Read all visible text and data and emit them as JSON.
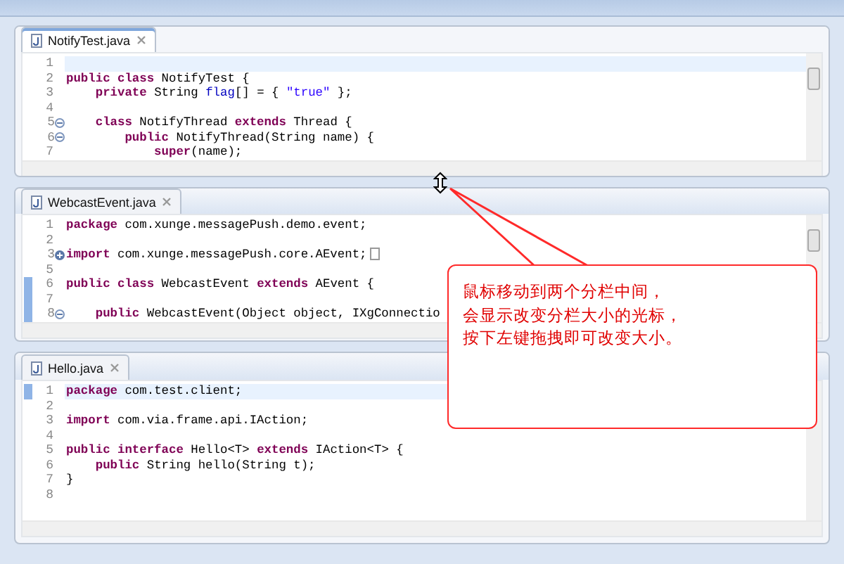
{
  "editors": [
    {
      "tab": {
        "label": "NotifyTest.java",
        "selected": true
      },
      "lines": [
        {
          "number": "1",
          "current": true
        },
        {
          "number": "2",
          "segments": [
            {
              "kind": "keyword",
              "text": "public class"
            },
            {
              "kind": "plain",
              "text": " NotifyTest {"
            }
          ]
        },
        {
          "number": "3",
          "segments": [
            {
              "kind": "keyword",
              "text": "    private"
            },
            {
              "kind": "plain",
              "text": " String "
            },
            {
              "kind": "field",
              "text": "flag"
            },
            {
              "kind": "plain",
              "text": "[] = { "
            },
            {
              "kind": "string",
              "text": "\"true\""
            },
            {
              "kind": "plain",
              "text": " };"
            }
          ]
        },
        {
          "number": "4"
        },
        {
          "number": "5",
          "fold": {
            "collapsed": false
          },
          "segments": [
            {
              "kind": "keyword",
              "text": "    class"
            },
            {
              "kind": "plain",
              "text": " NotifyThread "
            },
            {
              "kind": "keyword",
              "text": "extends"
            },
            {
              "kind": "plain",
              "text": " Thread {"
            }
          ]
        },
        {
          "number": "6",
          "fold": {
            "collapsed": false
          },
          "segments": [
            {
              "kind": "keyword",
              "text": "        public"
            },
            {
              "kind": "plain",
              "text": " NotifyThread(String name) {"
            }
          ]
        },
        {
          "number": "7",
          "segments": [
            {
              "kind": "keyword",
              "text": "            super"
            },
            {
              "kind": "plain",
              "text": "(name);"
            }
          ]
        }
      ]
    },
    {
      "tab": {
        "label": "WebcastEvent.java",
        "selected": false
      },
      "lines": [
        {
          "number": "1",
          "segments": [
            {
              "kind": "keyword",
              "text": "package"
            },
            {
              "kind": "plain",
              "text": " com.xunge.messagePush.demo.event;"
            }
          ]
        },
        {
          "number": "2"
        },
        {
          "number": "3",
          "fold": {
            "collapsed": true
          },
          "segments": [
            {
              "kind": "keyword",
              "text": "import"
            },
            {
              "kind": "plain",
              "text": " com.xunge.messagePush.core.AEvent;"
            }
          ]
        },
        {
          "number": "5"
        },
        {
          "number": "6",
          "changed": true,
          "segments": [
            {
              "kind": "keyword",
              "text": "public class"
            },
            {
              "kind": "plain",
              "text": " WebcastEvent "
            },
            {
              "kind": "keyword",
              "text": "extends"
            },
            {
              "kind": "plain",
              "text": " AEvent {"
            }
          ]
        },
        {
          "number": "7",
          "changed": true
        },
        {
          "number": "8",
          "changed": true,
          "fold": {
            "collapsed": false
          },
          "segments": [
            {
              "kind": "keyword",
              "text": "    public"
            },
            {
              "kind": "plain",
              "text": " WebcastEvent(Object object, IXgConnectio"
            }
          ]
        }
      ]
    },
    {
      "tab": {
        "label": "Hello.java",
        "selected": false
      },
      "lines": [
        {
          "number": "1",
          "current": true,
          "changed": true,
          "segments": [
            {
              "kind": "keyword",
              "text": "package"
            },
            {
              "kind": "plain",
              "text": " com.test.client;"
            }
          ]
        },
        {
          "number": "2"
        },
        {
          "number": "3",
          "segments": [
            {
              "kind": "keyword",
              "text": "import"
            },
            {
              "kind": "plain",
              "text": " com.via.frame.api.IAction;"
            }
          ]
        },
        {
          "number": "4"
        },
        {
          "number": "5",
          "segments": [
            {
              "kind": "keyword",
              "text": "public interface"
            },
            {
              "kind": "plain",
              "text": " Hello<T> "
            },
            {
              "kind": "keyword",
              "text": "extends"
            },
            {
              "kind": "plain",
              "text": " IAction<T> {"
            }
          ]
        },
        {
          "number": "6",
          "segments": [
            {
              "kind": "keyword",
              "text": "    public"
            },
            {
              "kind": "plain",
              "text": " String hello(String t);"
            }
          ]
        },
        {
          "number": "7",
          "segments": [
            {
              "kind": "plain",
              "text": "}"
            }
          ]
        },
        {
          "number": "8"
        }
      ]
    }
  ],
  "callout": {
    "lines": [
      "鼠标移动到两个分栏中间，",
      "会显示改变分栏大小的光标，",
      "按下左键拖拽即可改变大小。"
    ]
  }
}
